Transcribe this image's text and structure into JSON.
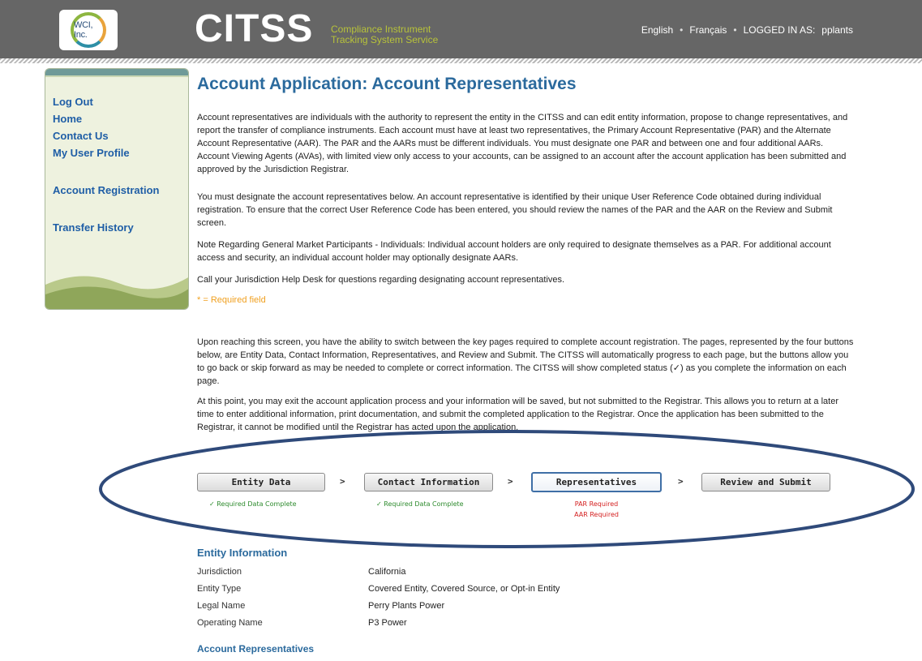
{
  "header": {
    "logo_text": "WCI, Inc.",
    "brand": "CITSS",
    "brand_sub_line1": "Compliance Instrument",
    "brand_sub_line2": "Tracking System Service",
    "lang_english": "English",
    "lang_french": "Français",
    "logged_in_label": "LOGGED IN AS:",
    "username": "pplants"
  },
  "sidebar": {
    "items": [
      {
        "label": "Log Out"
      },
      {
        "label": "Home"
      },
      {
        "label": "Contact Us"
      },
      {
        "label": "My User Profile"
      },
      {
        "label": "Account Registration"
      },
      {
        "label": "Transfer History"
      }
    ]
  },
  "main": {
    "title": "Account Application: Account Representatives",
    "para1": "Account representatives are individuals with the authority to represent the entity in the CITSS and can edit entity information, propose to change representatives, and report the transfer of compliance instruments. Each account must have at least two representatives, the Primary Account Representative (PAR) and the Alternate Account Representative (AAR). The PAR and the AARs must be different individuals. You must designate one PAR and between one and four additional AARs. Account Viewing Agents (AVAs), with limited view only access to your accounts, can be assigned to an account after the account application has been submitted and approved by the Jurisdiction Registrar.",
    "para2": "You must designate the account representatives below. An account representative is identified by their unique User Reference Code obtained during individual registration. To ensure that the correct User Reference Code has been entered, you should review the names of the PAR and the AAR on the Review and Submit screen.",
    "para3": "Note Regarding General Market Participants - Individuals: Individual account holders are only required to designate themselves as a PAR. For additional account access and security, an individual account holder may optionally designate AARs.",
    "para4": "Call your Jurisdiction Help Desk for questions regarding designating account representatives.",
    "required_note": "* = Required field",
    "para5": "Upon reaching this screen, you have the ability to switch between the key pages required to complete account registration. The pages, represented by the four buttons below, are Entity Data, Contact Information, Representatives, and Review and Submit. The CITSS will automatically progress to each page, but the buttons allow you to go back or skip forward as may be needed to complete or correct information. The CITSS will show completed status (✓) as you complete the information on each page.",
    "para6": "At this point, you may exit the account application process and your information will be saved, but not submitted to the Registrar. This allows you to return at a later time to enter additional information, print documentation, and submit the completed application to the Registrar. Once the application has been submitted to the Registrar, it cannot be modified until the Registrar has acted upon the application."
  },
  "steps": {
    "separator": ">",
    "entity_data": {
      "label": "Entity Data",
      "status": "✓ Required Data Complete"
    },
    "contact_info": {
      "label": "Contact Information",
      "status": "✓ Required Data Complete"
    },
    "representatives": {
      "label": "Representatives",
      "status1": "PAR Required",
      "status2": "AAR Required"
    },
    "review_submit": {
      "label": "Review and Submit"
    }
  },
  "entity_info": {
    "title": "Entity Information",
    "rows": [
      {
        "label": "Jurisdiction",
        "value": "California"
      },
      {
        "label": "Entity Type",
        "value": "Covered Entity, Covered Source, or Opt-in Entity"
      },
      {
        "label": "Legal Name",
        "value": "Perry Plants Power"
      },
      {
        "label": "Operating Name",
        "value": "P3 Power"
      }
    ]
  },
  "account_reps": {
    "title": "Account Representatives"
  },
  "colors": {
    "header_bg": "#666666",
    "title_blue": "#2b6a9d",
    "link_blue": "#1f5ea6",
    "ok_green": "#2e8b2e",
    "error_red": "#d42020",
    "ellipse": "#2f4a7a"
  }
}
